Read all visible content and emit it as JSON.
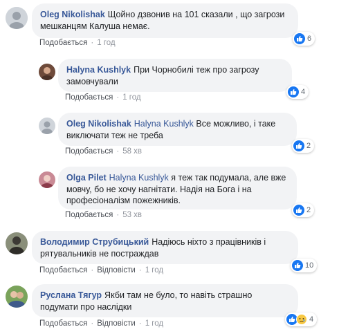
{
  "comments": [
    {
      "author": "Oleg Nikolishak",
      "mention": "",
      "text": "Щойно дзвонив на 101 сказали , що загрози мешканцям Калуша немає.",
      "like_label": "Подобається",
      "reply_label": "",
      "time": "1 год",
      "reactions": "6"
    },
    {
      "author": "Halyna Kushlyk",
      "mention": "",
      "text": "При Чорнобилі теж про загрозу замовчували",
      "like_label": "Подобається",
      "reply_label": "",
      "time": "1 год",
      "reactions": "4"
    },
    {
      "author": "Oleg Nikolishak",
      "mention": "Halyna Kushlyk",
      "text": "Все можливо, і таке виключати теж не треба",
      "like_label": "Подобається",
      "reply_label": "",
      "time": "58 хв",
      "reactions": "2"
    },
    {
      "author": "Olga Pilet",
      "mention": "Halyna Kushlyk",
      "text": "я теж так подумала, але вже мовчу, бо не хочу нагнітати. Надія на Бога і на професіоналізм пожежників.",
      "like_label": "Подобається",
      "reply_label": "",
      "time": "53 хв",
      "reactions": "2"
    },
    {
      "author": "Володимир Струбицький",
      "mention": "",
      "text": "Надіюсь ніхто з працівників і рятувальників не постраждав",
      "like_label": "Подобається",
      "reply_label": "Відповісти",
      "time": "1 год",
      "reactions": "10"
    },
    {
      "author": "Руслана Тягур",
      "mention": "",
      "text": "Якби там не було, то навіть страшно подумати про наслідки",
      "like_label": "Подобається",
      "reply_label": "Відповісти",
      "time": "1 год",
      "reactions": "4"
    }
  ],
  "colors": {
    "link": "#385898",
    "bubble": "#f2f3f5",
    "like_blue": "#1877f2",
    "sad_yellow": "#f7c843"
  },
  "icons": {
    "like": "thumbs-up-icon",
    "sad": "sad-face-icon"
  }
}
